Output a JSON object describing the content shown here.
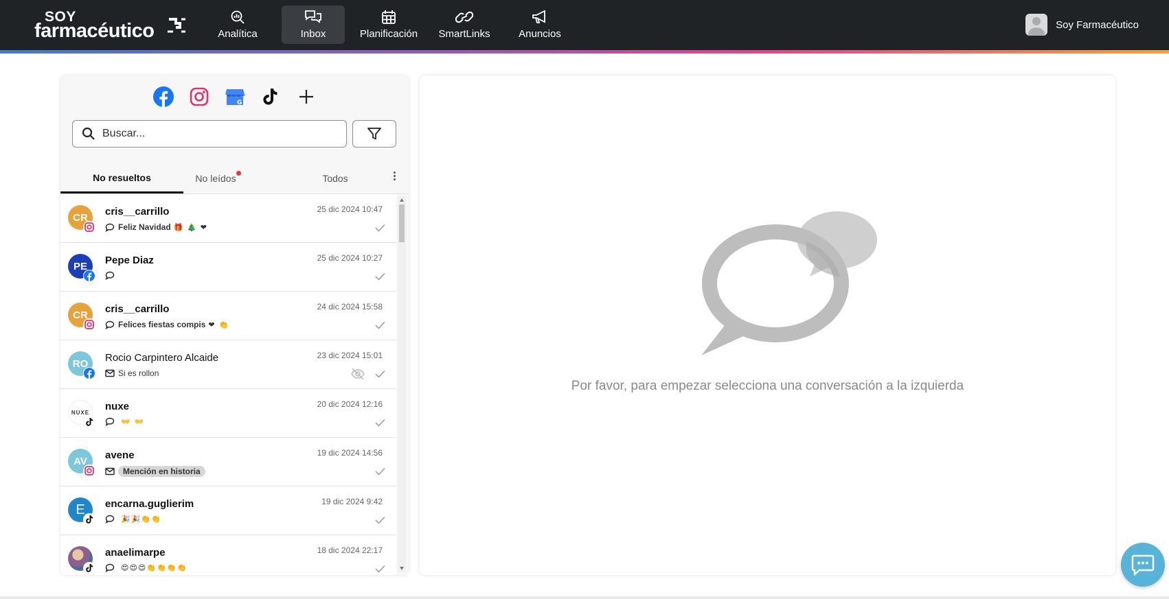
{
  "brand": {
    "line1": "SOY",
    "line2": "farmacéutico"
  },
  "nav": [
    {
      "label": "Analítica",
      "icon": "analytics-icon",
      "active": false
    },
    {
      "label": "Inbox",
      "icon": "inbox-icon",
      "active": true
    },
    {
      "label": "Planificación",
      "icon": "calendar-icon",
      "active": false
    },
    {
      "label": "SmartLinks",
      "icon": "link-icon",
      "active": false
    },
    {
      "label": "Anuncios",
      "icon": "megaphone-icon",
      "active": false
    }
  ],
  "user": {
    "name": "Soy Farmacéutico"
  },
  "channels": [
    "facebook-icon",
    "instagram-icon",
    "google-business-icon",
    "tiktok-icon",
    "add-icon"
  ],
  "search": {
    "placeholder": "Buscar..."
  },
  "tabs": [
    {
      "label": "No resueltos",
      "active": true
    },
    {
      "label": "No leídos",
      "active": false,
      "has_dot": true
    },
    {
      "label": "Todos",
      "active": false
    }
  ],
  "conversations": [
    {
      "initials": "CR",
      "color": "#e8a23a",
      "network": "instagram",
      "name": "cris__carrillo",
      "date": "25 dic 2024 10:47",
      "preview_type": "comment",
      "preview": "Feliz Navidad",
      "emoji": "🎁 🎄 ❤",
      "unread": true
    },
    {
      "initials": "PE",
      "color": "#1a3fb8",
      "network": "facebook",
      "name": "Pepe Diaz",
      "date": "25 dic 2024 10:27",
      "preview_type": "comment",
      "preview": "",
      "emoji": "",
      "unread": true
    },
    {
      "initials": "CR",
      "color": "#e8a23a",
      "network": "instagram",
      "name": "cris__carrillo",
      "date": "24 dic 2024 15:58",
      "preview_type": "comment",
      "preview": "Felices fiestas compis",
      "emoji": "❤ 👏",
      "unread": true
    },
    {
      "initials": "RO",
      "color": "#7cc7d9",
      "network": "facebook",
      "name": "Rocio Carpintero Alcaide",
      "date": "23 dic 2024 15:01",
      "preview_type": "message",
      "preview": "Si es rollon",
      "emoji": "",
      "unread": false,
      "hidden": true
    },
    {
      "initials": "NUXE",
      "color": "#ffffff",
      "network": "tiktok",
      "name": "nuxe",
      "date": "20 dic 2024 12:16",
      "preview_type": "comment",
      "preview": "",
      "emoji": "👐 👐",
      "unread": true
    },
    {
      "initials": "AV",
      "color": "#7cc7d9",
      "network": "instagram",
      "name": "avene",
      "date": "19 dic 2024 14:56",
      "preview_type": "message",
      "preview": "Mención en historia",
      "pill": true,
      "emoji": "",
      "unread": true
    },
    {
      "initials": "E",
      "color": "#1f86c9",
      "network": "tiktok",
      "name": "encarna.guglierim",
      "date": "19 dic 2024 9:42",
      "preview_type": "comment",
      "preview": "",
      "emoji": "🎉🎉👏👏",
      "unread": true
    },
    {
      "initials": "",
      "color": "#a57aa0",
      "network": "tiktok",
      "name": "anaelimarpe",
      "date": "18 dic 2024 22:17",
      "preview_type": "comment",
      "preview": "",
      "emoji": "😍😍😍👏👏👏👏",
      "unread": true
    }
  ],
  "empty_state": {
    "message": "Por favor, para empezar selecciona una conversación a la izquierda"
  }
}
